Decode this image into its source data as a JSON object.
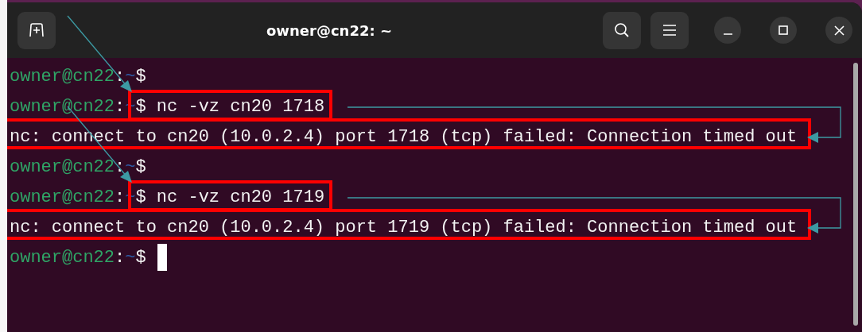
{
  "window": {
    "title": "owner@cn22: ~"
  },
  "lines": [
    {
      "kind": "prompt",
      "user": "owner@cn22",
      "separator": ":",
      "path": "~",
      "symbol": "$",
      "highlighted": false,
      "cursor": false
    },
    {
      "kind": "prompt",
      "user": "owner@cn22",
      "separator": ":",
      "path": "~",
      "symbol": "$",
      "command": "nc -vz cn20 1718",
      "highlighted": true,
      "cursor": false
    },
    {
      "kind": "output",
      "text": "nc: connect to cn20 (10.0.2.4) port 1718 (tcp) failed: Connection timed out",
      "highlighted": true
    },
    {
      "kind": "prompt",
      "user": "owner@cn22",
      "separator": ":",
      "path": "~",
      "symbol": "$",
      "highlighted": false,
      "cursor": false
    },
    {
      "kind": "prompt",
      "user": "owner@cn22",
      "separator": ":",
      "path": "~",
      "symbol": "$",
      "command": "nc -vz cn20 1719",
      "highlighted": true,
      "cursor": false
    },
    {
      "kind": "output",
      "text": "nc: connect to cn20 (10.0.2.4) port 1719 (tcp) failed: Connection timed out",
      "highlighted": true
    },
    {
      "kind": "prompt",
      "user": "owner@cn22",
      "separator": ":",
      "path": "~",
      "symbol": "$",
      "highlighted": false,
      "cursor": true
    }
  ]
}
